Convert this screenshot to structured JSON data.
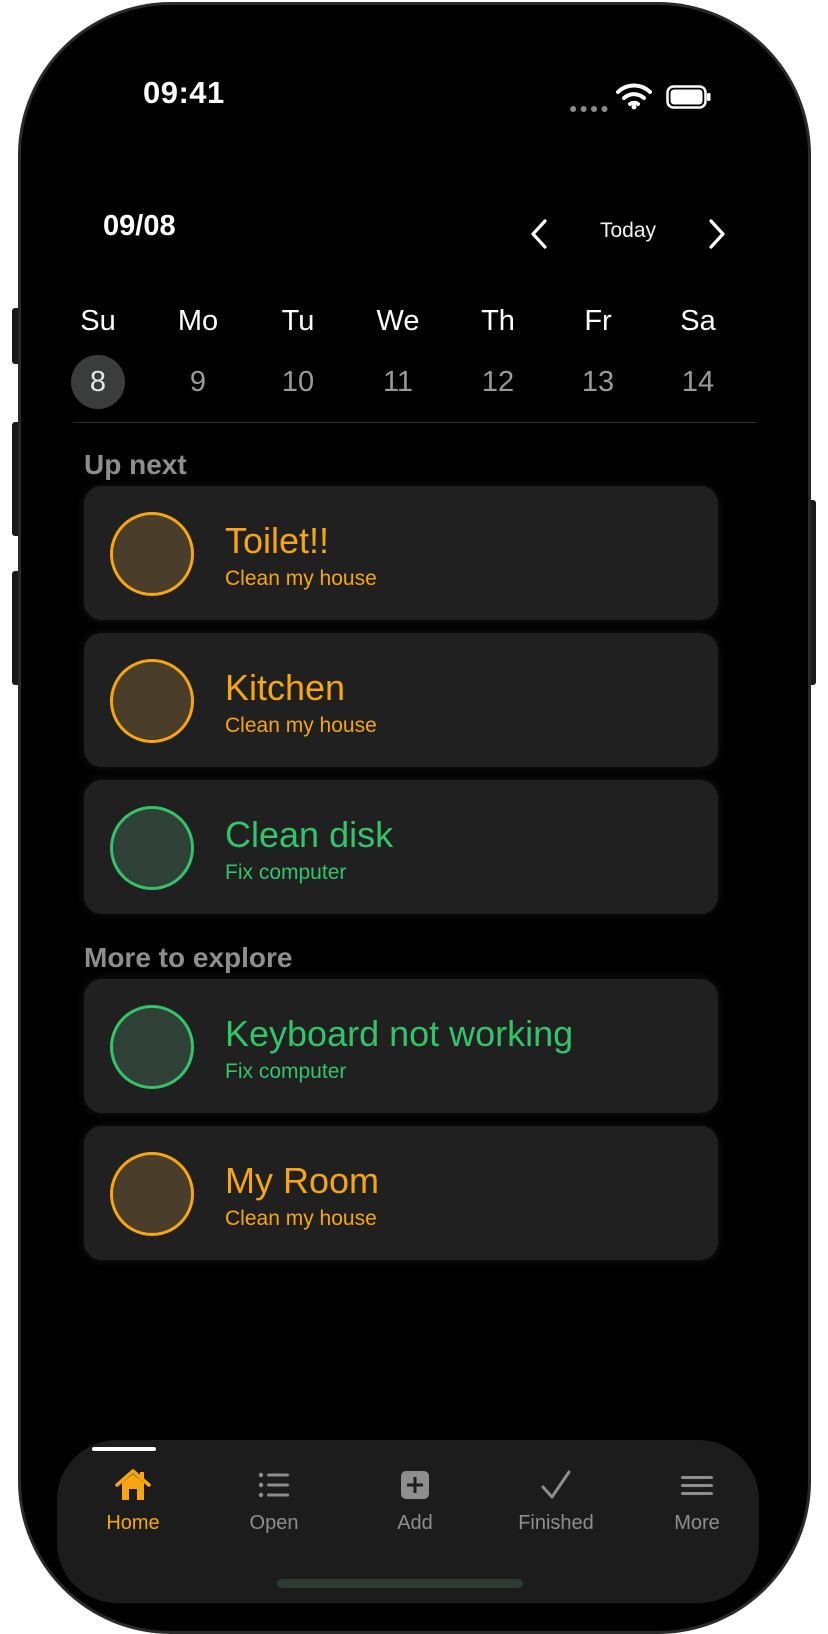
{
  "colors": {
    "accent": "#f6a612",
    "green": "#33c46a",
    "orange_fill": "#4a3d2a",
    "green_fill": "#2f4136",
    "muted": "#8e8e8e",
    "card_bg": "#202020"
  },
  "status": {
    "time": "09:41"
  },
  "header": {
    "date": "09/08",
    "today_label": "Today"
  },
  "week": {
    "days": [
      {
        "name": "Su",
        "num": "8",
        "selected": true
      },
      {
        "name": "Mo",
        "num": "9",
        "selected": false
      },
      {
        "name": "Tu",
        "num": "10",
        "selected": false
      },
      {
        "name": "We",
        "num": "11",
        "selected": false
      },
      {
        "name": "Th",
        "num": "12",
        "selected": false
      },
      {
        "name": "Fr",
        "num": "13",
        "selected": false
      },
      {
        "name": "Sa",
        "num": "14",
        "selected": false
      }
    ]
  },
  "sections": {
    "up_next": "Up next",
    "more_to_explore": "More to explore"
  },
  "tasks": [
    {
      "title": "Toilet!!",
      "subtitle": "Clean my house",
      "color": "orange"
    },
    {
      "title": "Kitchen",
      "subtitle": "Clean my house",
      "color": "orange"
    },
    {
      "title": "Clean disk",
      "subtitle": "Fix computer",
      "color": "green"
    },
    {
      "title": "Keyboard not working",
      "subtitle": "Fix computer",
      "color": "green"
    },
    {
      "title": "My Room",
      "subtitle": "Clean my house",
      "color": "orange"
    }
  ],
  "tabbar": {
    "tabs": [
      {
        "label": "Home",
        "icon": "home-icon",
        "active": true
      },
      {
        "label": "Open",
        "icon": "list-icon",
        "active": false
      },
      {
        "label": "Add",
        "icon": "plus-square-icon",
        "active": false
      },
      {
        "label": "Finished",
        "icon": "checkmark-icon",
        "active": false
      },
      {
        "label": "More",
        "icon": "menu-icon",
        "active": false
      }
    ]
  }
}
